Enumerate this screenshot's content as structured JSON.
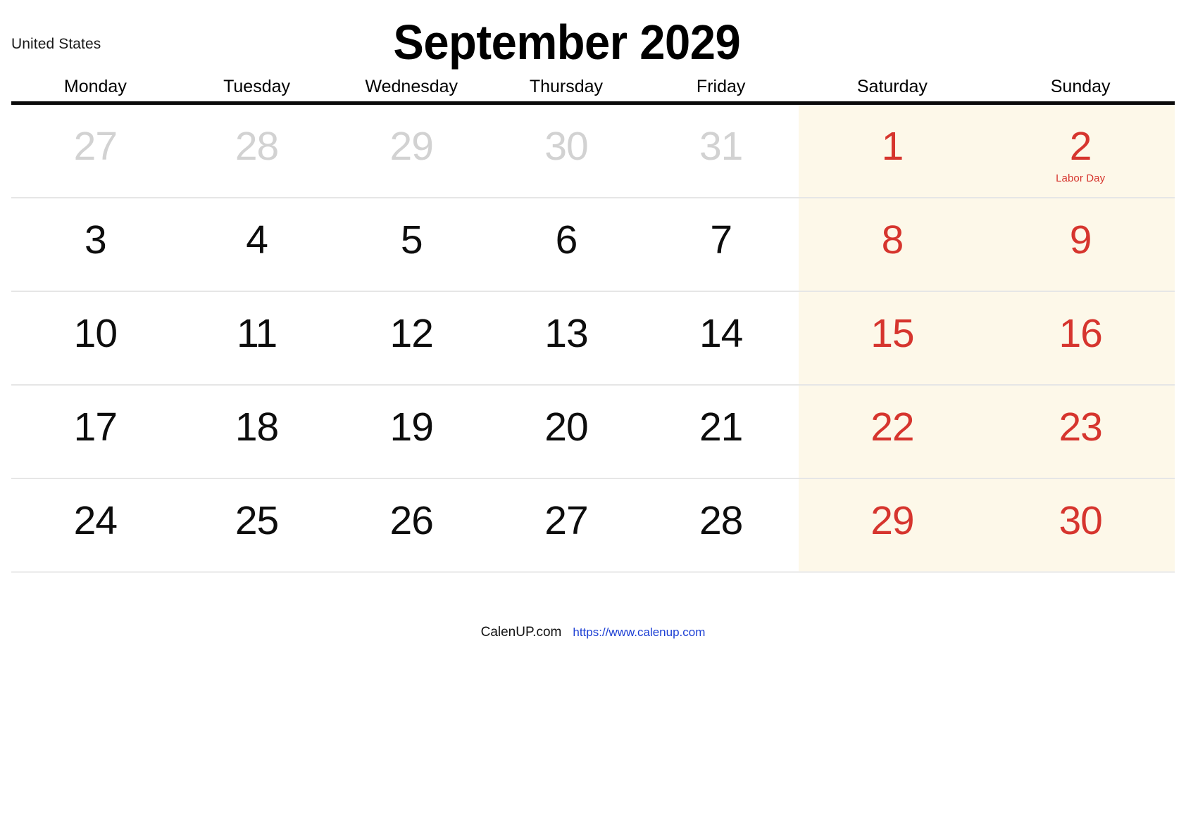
{
  "header": {
    "country": "United States",
    "title": "September 2029"
  },
  "weekdays": [
    {
      "label": "Monday",
      "weekend": false
    },
    {
      "label": "Tuesday",
      "weekend": false
    },
    {
      "label": "Wednesday",
      "weekend": false
    },
    {
      "label": "Thursday",
      "weekend": false
    },
    {
      "label": "Friday",
      "weekend": false
    },
    {
      "label": "Saturday",
      "weekend": true
    },
    {
      "label": "Sunday",
      "weekend": true
    }
  ],
  "colors": {
    "weekend_background": "#fdf8e9",
    "weekend_text": "#d6352e",
    "other_month_text": "#d2d2d2",
    "in_month_text": "#0d0d0d",
    "header_rule": "#0a0a0a",
    "link": "#1c3fd4"
  },
  "weeks": [
    [
      {
        "day": "27",
        "style": "muted",
        "weekend": false,
        "holiday": ""
      },
      {
        "day": "28",
        "style": "muted",
        "weekend": false,
        "holiday": ""
      },
      {
        "day": "29",
        "style": "muted",
        "weekend": false,
        "holiday": ""
      },
      {
        "day": "30",
        "style": "muted",
        "weekend": false,
        "holiday": ""
      },
      {
        "day": "31",
        "style": "muted",
        "weekend": false,
        "holiday": ""
      },
      {
        "day": "1",
        "style": "red",
        "weekend": true,
        "holiday": ""
      },
      {
        "day": "2",
        "style": "red",
        "weekend": true,
        "holiday": "Labor Day"
      }
    ],
    [
      {
        "day": "3",
        "style": "normal",
        "weekend": false,
        "holiday": ""
      },
      {
        "day": "4",
        "style": "normal",
        "weekend": false,
        "holiday": ""
      },
      {
        "day": "5",
        "style": "normal",
        "weekend": false,
        "holiday": ""
      },
      {
        "day": "6",
        "style": "normal",
        "weekend": false,
        "holiday": ""
      },
      {
        "day": "7",
        "style": "normal",
        "weekend": false,
        "holiday": ""
      },
      {
        "day": "8",
        "style": "red",
        "weekend": true,
        "holiday": ""
      },
      {
        "day": "9",
        "style": "red",
        "weekend": true,
        "holiday": ""
      }
    ],
    [
      {
        "day": "10",
        "style": "normal",
        "weekend": false,
        "holiday": ""
      },
      {
        "day": "11",
        "style": "normal",
        "weekend": false,
        "holiday": ""
      },
      {
        "day": "12",
        "style": "normal",
        "weekend": false,
        "holiday": ""
      },
      {
        "day": "13",
        "style": "normal",
        "weekend": false,
        "holiday": ""
      },
      {
        "day": "14",
        "style": "normal",
        "weekend": false,
        "holiday": ""
      },
      {
        "day": "15",
        "style": "red",
        "weekend": true,
        "holiday": ""
      },
      {
        "day": "16",
        "style": "red",
        "weekend": true,
        "holiday": ""
      }
    ],
    [
      {
        "day": "17",
        "style": "normal",
        "weekend": false,
        "holiday": ""
      },
      {
        "day": "18",
        "style": "normal",
        "weekend": false,
        "holiday": ""
      },
      {
        "day": "19",
        "style": "normal",
        "weekend": false,
        "holiday": ""
      },
      {
        "day": "20",
        "style": "normal",
        "weekend": false,
        "holiday": ""
      },
      {
        "day": "21",
        "style": "normal",
        "weekend": false,
        "holiday": ""
      },
      {
        "day": "22",
        "style": "red",
        "weekend": true,
        "holiday": ""
      },
      {
        "day": "23",
        "style": "red",
        "weekend": true,
        "holiday": ""
      }
    ],
    [
      {
        "day": "24",
        "style": "normal",
        "weekend": false,
        "holiday": ""
      },
      {
        "day": "25",
        "style": "normal",
        "weekend": false,
        "holiday": ""
      },
      {
        "day": "26",
        "style": "normal",
        "weekend": false,
        "holiday": ""
      },
      {
        "day": "27",
        "style": "normal",
        "weekend": false,
        "holiday": ""
      },
      {
        "day": "28",
        "style": "normal",
        "weekend": false,
        "holiday": ""
      },
      {
        "day": "29",
        "style": "red",
        "weekend": true,
        "holiday": ""
      },
      {
        "day": "30",
        "style": "red",
        "weekend": true,
        "holiday": ""
      }
    ]
  ],
  "footer": {
    "brand": "CalenUP.com",
    "url": "https://www.calenup.com"
  }
}
